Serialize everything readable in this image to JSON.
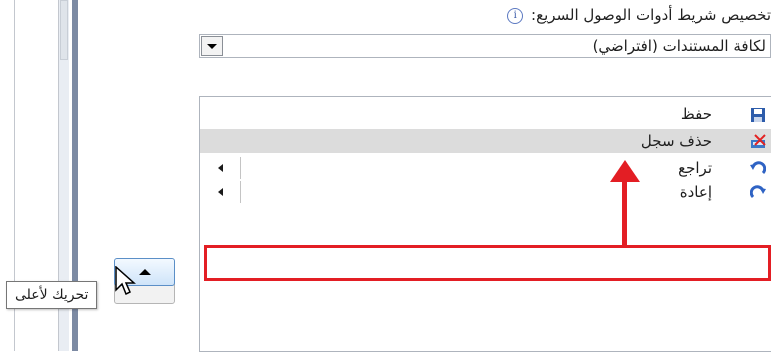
{
  "qat": {
    "title": "تخصيص شريط أدوات الوصول السريع:",
    "info_glyph": "i"
  },
  "document_select": {
    "value": "لكافة المستندات (افتراضي)"
  },
  "commands": [
    {
      "label": "حفظ",
      "icon": "save-icon",
      "selected": false,
      "has_submenu": false
    },
    {
      "label": "حذف سجل",
      "icon": "delete-record-icon",
      "selected": true,
      "has_submenu": false
    },
    {
      "label": "تراجع",
      "icon": "undo-icon",
      "selected": false,
      "has_submenu": true
    },
    {
      "label": "إعادة",
      "icon": "redo-icon",
      "selected": false,
      "has_submenu": true
    }
  ],
  "tooltip": {
    "text": "تحريك لأعلى"
  },
  "colors": {
    "highlight": "#e31e24",
    "selected_row": "#dcdcdc",
    "button_border": "#5b8fc7"
  }
}
